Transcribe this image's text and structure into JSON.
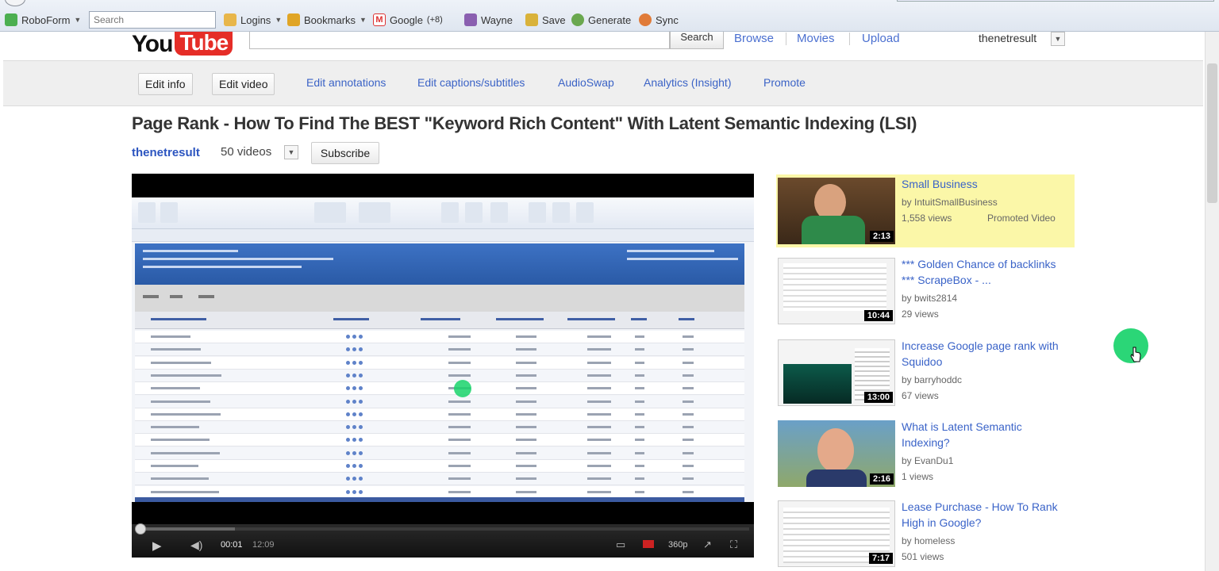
{
  "browser_toolbar": {
    "roboform_label": "RoboForm",
    "search_placeholder": "Search",
    "items": [
      {
        "label": "Logins",
        "icon": "folder-icon"
      },
      {
        "label": "Bookmarks",
        "icon": "bookmark-icon"
      },
      {
        "label": "Google",
        "icon": "gmail-icon"
      },
      {
        "label": "(+8)",
        "icon": ""
      },
      {
        "label": "Wayne",
        "icon": "identity-icon"
      },
      {
        "label": "Save",
        "icon": "save-icon"
      },
      {
        "label": "Generate",
        "icon": "generate-icon"
      },
      {
        "label": "Sync",
        "icon": "sync-icon"
      }
    ]
  },
  "youtube": {
    "logo_you": "You",
    "logo_tube": "Tube",
    "search_button": "Search",
    "nav": [
      "Browse",
      "Movies",
      "Upload"
    ],
    "username": "thenetresult"
  },
  "edit_bar": {
    "buttons": [
      "Edit info",
      "Edit video"
    ],
    "links": [
      "Edit annotations",
      "Edit captions/subtitles",
      "AudioSwap",
      "Analytics (Insight)",
      "Promote"
    ]
  },
  "video": {
    "title": "Page Rank - How To Find The BEST \"Keyword Rich Content\" With Latent Semantic Indexing (LSI)",
    "channel": "thenetresult",
    "video_count": "50 videos",
    "subscribe_label": "Subscribe",
    "time_current": "00:01",
    "time_total": "12:09",
    "progress_fraction": 0.003,
    "quality": "360p"
  },
  "related": [
    {
      "title": "Small Business",
      "by": "by IntuitSmallBusiness",
      "views": "1,558 views",
      "duration": "2:13",
      "promoted": "Promoted Video"
    },
    {
      "title": "*** Golden Chance of backlinks *** ScrapeBox - ...",
      "by": "by bwits2814",
      "views": "29 views",
      "duration": "10:44"
    },
    {
      "title": "Increase Google page rank with Squidoo",
      "by": "by barryhoddc",
      "views": "67 views",
      "duration": "13:00"
    },
    {
      "title": "What is Latent Semantic Indexing?",
      "by": "by EvanDu1",
      "views": "1 views",
      "duration": "2:16"
    },
    {
      "title": "Lease Purchase - How To Rank High in Google?",
      "by": "by homeless",
      "views": "501 views",
      "duration": "7:17"
    }
  ],
  "colors": {
    "accent_link": "#3a63c8",
    "logo_red": "#e52d27",
    "promo_bg": "#fbf7a8",
    "cursor_highlight": "#19d36b"
  }
}
